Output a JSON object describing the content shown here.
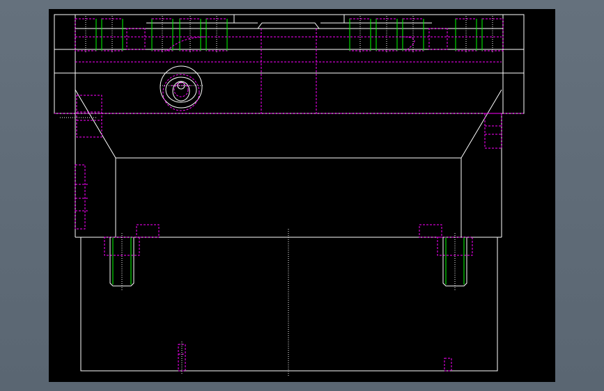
{
  "colors": {
    "frame_background": "#5e6a76",
    "canvas_background": "#000000",
    "outline": "#ffffff",
    "hidden_line": "#ff00ff",
    "thread": "#00ff00",
    "centerline": "#ffffff"
  }
}
